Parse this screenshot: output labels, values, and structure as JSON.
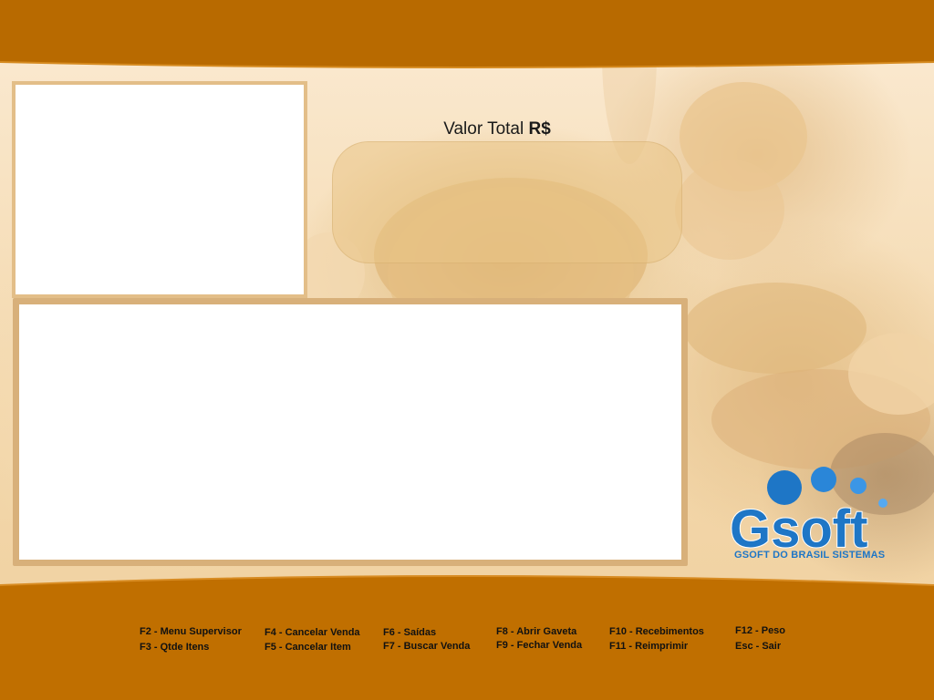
{
  "total": {
    "label_text": "Valor Total",
    "label_currency": "R$",
    "value": ""
  },
  "shortcuts": [
    {
      "id": "f2",
      "label": "F2 - Menu Supervisor"
    },
    {
      "id": "f3",
      "label": "F3 - Qtde Itens"
    },
    {
      "id": "f4",
      "label": "F4 - Cancelar Venda"
    },
    {
      "id": "f5",
      "label": "F5 - Cancelar Item"
    },
    {
      "id": "f6",
      "label": "F6 - Saídas"
    },
    {
      "id": "f7",
      "label": "F7 - Buscar Venda"
    },
    {
      "id": "f8",
      "label": "F8 - Abrir Gaveta"
    },
    {
      "id": "f9",
      "label": "F9 - Fechar Venda"
    },
    {
      "id": "f10",
      "label": "F10 - Recebimentos"
    },
    {
      "id": "f11",
      "label": "F11 - Reimprimir"
    },
    {
      "id": "f12",
      "label": "F12 - Peso"
    },
    {
      "id": "esc",
      "label": "Esc - Sair"
    }
  ],
  "brand": {
    "logo_word": "Gsoft",
    "company_name": "GSOFT DO BRASIL SISTEMAS"
  },
  "colors": {
    "bar_brown": "#b86a00",
    "logo_blue": "#1e76c6"
  }
}
